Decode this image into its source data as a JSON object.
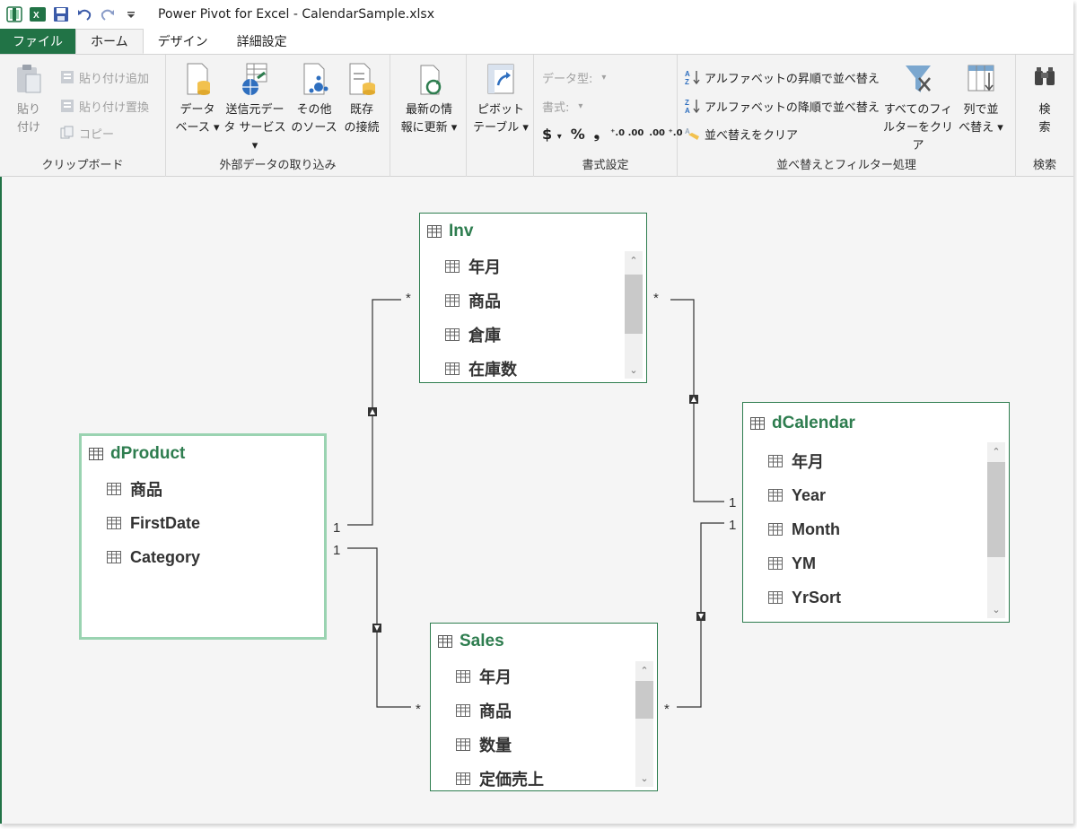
{
  "app": {
    "title": "Power Pivot for Excel - CalendarSample.xlsx"
  },
  "tabs": [
    {
      "label": "ファイル"
    },
    {
      "label": "ホーム"
    },
    {
      "label": "デザイン"
    },
    {
      "label": "詳細設定"
    }
  ],
  "ribbon": {
    "clipboard": {
      "label": "クリップボード",
      "paste": "貼り付け",
      "paste_line1": "貼り",
      "paste_line2": "付け",
      "paste_append": "貼り付け追加",
      "paste_replace": "貼り付け置換",
      "copy": "コピー"
    },
    "external": {
      "label": "外部データの取り込み",
      "database_l1": "データ",
      "database_l2": "ベース ▾",
      "dataservice_l1": "送信元デー",
      "dataservice_l2": "タ サービス ▾",
      "other_l1": "その他",
      "other_l2": "のソース",
      "existing_l1": "既存",
      "existing_l2": "の接続"
    },
    "refresh": {
      "l1": "最新の情",
      "l2": "報に更新 ▾"
    },
    "pivot": {
      "l1": "ピボット",
      "l2": "テーブル ▾"
    },
    "format": {
      "label": "書式設定",
      "datatype": "データ型:",
      "format": "書式:",
      "currency": "$",
      "percent": "%",
      "comma": "❟",
      "inc_decimal": "⁺.0 .00",
      "dec_decimal": ".00 ⁺.0"
    },
    "sort": {
      "label": "並べ替えとフィルター処理",
      "asc": "アルファベットの昇順で並べ替え",
      "desc": "アルファベットの降順で並べ替え",
      "clear_sort": "並べ替えをクリア",
      "clear_filter_l1": "すべてのフィ",
      "clear_filter_l2": "ルターをクリア",
      "sort_by_col_l1": "列で並",
      "sort_by_col_l2": "べ替え ▾"
    },
    "search": {
      "label": "検索",
      "btn_l1": "検",
      "btn_l2": "索"
    }
  },
  "diagram": {
    "tables": {
      "inv": {
        "name": "Inv",
        "fields": [
          "年月",
          "商品",
          "倉庫",
          "在庫数"
        ]
      },
      "dproduct": {
        "name": "dProduct",
        "fields": [
          "商品",
          "FirstDate",
          "Category"
        ]
      },
      "dcalendar": {
        "name": "dCalendar",
        "fields": [
          "年月",
          "Year",
          "Month",
          "YM",
          "YrSort"
        ]
      },
      "sales": {
        "name": "Sales",
        "fields": [
          "年月",
          "商品",
          "数量",
          "定価売上"
        ]
      }
    },
    "relationships": {
      "inv_many_left": "*",
      "inv_many_right": "*",
      "dproduct_one_top": "1",
      "dproduct_one_bottom": "1",
      "dcalendar_one_top": "1",
      "dcalendar_one_bottom": "1",
      "sales_many_left": "*",
      "sales_many_right": "*"
    },
    "colors": {
      "table_border": "#2e7d4f",
      "selected_border": "#9ad3b1",
      "header_text": "#2e7d4f",
      "accent": "#217346"
    }
  }
}
